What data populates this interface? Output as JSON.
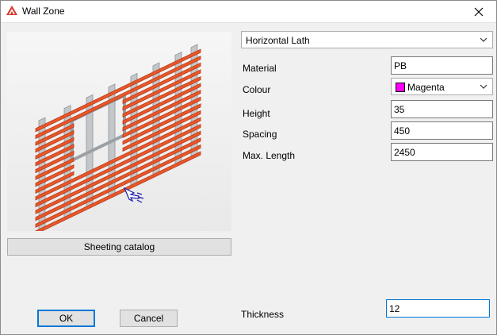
{
  "window": {
    "title": "Wall Zone"
  },
  "preview": {
    "image": "wall-frame-with-window-preview"
  },
  "sheeting_catalog_label": "Sheeting catalog",
  "zone_type": {
    "selected": "Horizontal Lath"
  },
  "fields": {
    "material": {
      "label": "Material",
      "value": "PB"
    },
    "colour": {
      "label": "Colour",
      "value": "Magenta",
      "swatch_color": "#ff00ff"
    },
    "height": {
      "label": "Height",
      "value": "35"
    },
    "spacing": {
      "label": "Spacing",
      "value": "450"
    },
    "max_length": {
      "label": "Max. Length",
      "value": "2450"
    },
    "thickness": {
      "label": "Thickness",
      "value": "12"
    }
  },
  "buttons": {
    "ok": "OK",
    "cancel": "Cancel"
  },
  "colors": {
    "lath": "#e8572a",
    "frame": "#b8bcc0"
  }
}
